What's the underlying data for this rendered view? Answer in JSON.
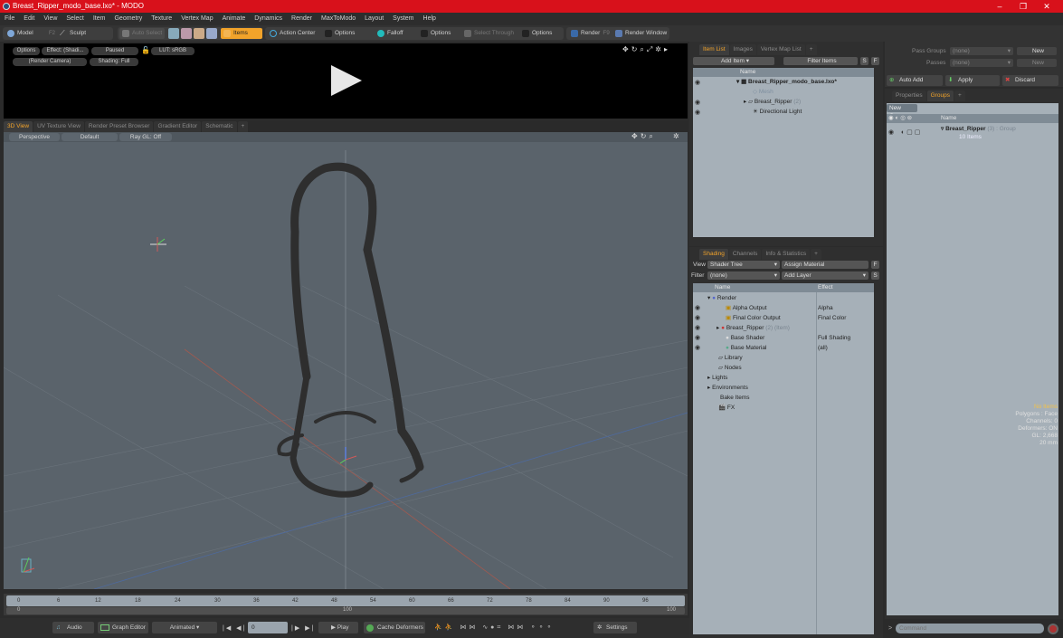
{
  "window": {
    "title": "Breast_Ripper_modo_base.lxo* - MODO",
    "minimize": "–",
    "maximize": "❐",
    "close": "✕"
  },
  "menu": [
    "File",
    "Edit",
    "View",
    "Select",
    "Item",
    "Geometry",
    "Texture",
    "Vertex Map",
    "Animate",
    "Dynamics",
    "Render",
    "MaxToModo",
    "Layout",
    "System",
    "Help"
  ],
  "toolbar": {
    "model": "Model",
    "f2": "F2",
    "sculpt": "Sculpt",
    "auto_select": "Auto Select",
    "items": "Items",
    "action_center": "Action Center",
    "options1": "Options",
    "falloff": "Falloff",
    "options2": "Options",
    "select_through": "Select Through",
    "options3": "Options",
    "render": "Render",
    "f9": "F9",
    "render_window": "Render Window"
  },
  "preview": {
    "options": "Options",
    "effect": "Effect: (Shadi...",
    "paused": "Paused",
    "lut": "LUT: sRGB",
    "camera": "(Render Camera)",
    "shading": "Shading: Full"
  },
  "viewport_tabs": [
    "3D View",
    "UV Texture View",
    "Render Preset Browser",
    "Gradient Editor",
    "Schematic",
    "+"
  ],
  "viewport": {
    "perspective": "Perspective",
    "default": "Default",
    "raygl": "Ray GL: Off",
    "stats": {
      "items": "No Items",
      "polygons": "Polygons : Face",
      "channels": "Channels: 0",
      "deformers": "Deformers: ON",
      "gl": "GL: 2,668",
      "unit": "20 mm"
    }
  },
  "timeline": {
    "ticks": [
      "0",
      "6",
      "12",
      "18",
      "24",
      "30",
      "36",
      "42",
      "48",
      "54",
      "60",
      "66",
      "72",
      "78",
      "84",
      "90",
      "96"
    ],
    "range_start": "0",
    "range_mid": "100",
    "range_end": "100"
  },
  "bottom": {
    "audio": "Audio",
    "graph_editor": "Graph Editor",
    "animated": "Animated",
    "frame": "0",
    "play": "Play",
    "cache_deformers": "Cache Deformers",
    "settings": "Settings"
  },
  "item_list": {
    "tabs": [
      "Item List",
      "Images",
      "Vertex Map List",
      "+"
    ],
    "add_item": "Add Item",
    "filter_items": "Filter Items",
    "s": "S",
    "f": "F",
    "col_name": "Name",
    "rows": [
      {
        "name": "Breast_Ripper_modo_base.lxo*",
        "bold": true
      },
      {
        "name": "Mesh",
        "dim": true
      },
      {
        "name": "Breast_Ripper",
        "suffix": "(2)"
      },
      {
        "name": "Directional Light"
      }
    ]
  },
  "shading": {
    "tabs": [
      "Shading",
      "Channels",
      "Info & Statistics",
      "+"
    ],
    "view_label": "View",
    "view_value": "Shader Tree",
    "assign_material": "Assign Material",
    "f": "F",
    "filter_label": "Filter",
    "filter_value": "(none)",
    "add_layer": "Add Layer",
    "s": "S",
    "col_name": "Name",
    "col_effect": "Effect",
    "rows": [
      {
        "name": "Render",
        "effect": ""
      },
      {
        "name": "Alpha Output",
        "effect": "Alpha"
      },
      {
        "name": "Final Color Output",
        "effect": "Final Color"
      },
      {
        "name": "Breast_Ripper",
        "suffix": "(2) (Item)",
        "effect": ""
      },
      {
        "name": "Base Shader",
        "effect": "Full Shading"
      },
      {
        "name": "Base Material",
        "effect": "(all)"
      },
      {
        "name": "Library",
        "effect": ""
      },
      {
        "name": "Nodes",
        "effect": ""
      },
      {
        "name": "Lights",
        "effect": ""
      },
      {
        "name": "Environments",
        "effect": ""
      },
      {
        "name": "Bake Items",
        "effect": ""
      },
      {
        "name": "FX",
        "effect": ""
      }
    ]
  },
  "passes": {
    "pass_groups_label": "Pass Groups",
    "pass_groups_value": "(none)",
    "passes_label": "Passes",
    "passes_value": "(none)",
    "new1": "New",
    "new2": "New",
    "auto_add": "Auto Add",
    "apply": "Apply",
    "discard": "Discard"
  },
  "groups": {
    "tabs": [
      "Properties",
      "Groups",
      "+"
    ],
    "new_group": "New Group",
    "col_name": "Name",
    "row_name": "Breast_Ripper",
    "row_suffix": "(3) : Group",
    "row_sub": "10 Items"
  },
  "command": {
    "placeholder": "Command"
  }
}
